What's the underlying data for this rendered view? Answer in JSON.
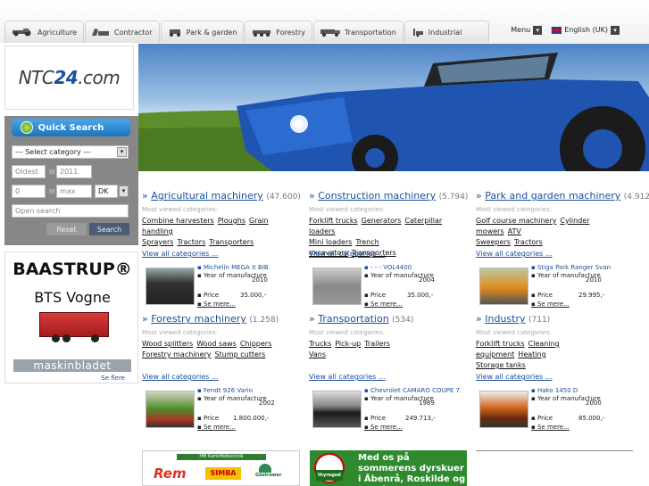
{
  "nav": {
    "tabs": [
      {
        "label": "Agriculture",
        "icon": "tractor-icon"
      },
      {
        "label": "Contractor",
        "icon": "excavator-icon"
      },
      {
        "label": "Park & garden",
        "icon": "mower-icon"
      },
      {
        "label": "Forestry",
        "icon": "forwarder-icon"
      },
      {
        "label": "Transportation",
        "icon": "truck-icon"
      },
      {
        "label": "Industrial",
        "icon": "forklift-icon"
      }
    ],
    "menu_label": "Menu",
    "language_label": "English (UK)"
  },
  "logo": {
    "text_a": "NTC",
    "text_b": "24",
    "text_c": ".com"
  },
  "quick_search": {
    "title": "Quick Search",
    "category_placeholder": "--- Select category ---",
    "year_from_placeholder": "Oldest",
    "year_to_value": "2011",
    "year_sep": "til",
    "price_from_value": "0",
    "price_to_placeholder": "max",
    "currency": "DK",
    "open_search_placeholder": "Open search",
    "reset_label": "Reset",
    "search_label": "Search"
  },
  "ads": {
    "baastrup_title": "BAASTRUP®",
    "baastrup_sub": "BTS Vogne",
    "maskinbladet": "maskinbladet",
    "see_more": "Se flere"
  },
  "categories": [
    {
      "title": "Agricultural machinery",
      "count": "(47.600)",
      "most_viewed": "Most viewed categories:",
      "links": [
        "Combine harvesters",
        "Ploughs",
        "Grain handling",
        "Sprayers",
        "Tractors",
        "Transporters"
      ],
      "view_all": "View all categories ...",
      "featured": {
        "title": "Michelin MEGA X BIB",
        "year_label": "Year of manufacture",
        "year": "2010",
        "price_label": "Price",
        "price": "35.000,-",
        "more": "Se mere..."
      }
    },
    {
      "title": "Construction machinery",
      "count": "(5.794)",
      "most_viewed": "Most viewed categories:",
      "links": [
        "Forklift trucks",
        "Generators",
        "Caterpillar loaders",
        "Mini loaders",
        "Trench excavators",
        "Transporters"
      ],
      "view_all": "View all categories ...",
      "featured": {
        "title": "- - - VOL4400",
        "year_label": "Year of manufacture",
        "year": "2004",
        "price_label": "Price",
        "price": "35.000,-",
        "more": "Se mere..."
      }
    },
    {
      "title": "Park and garden machinery",
      "count": "(4.912)",
      "most_viewed": "Most viewed categories:",
      "links": [
        "Golf course machinery",
        "Cylinder mowers",
        "ATV",
        "Sweepers",
        "Tractors"
      ],
      "view_all": "View all categories ...",
      "featured": {
        "title": "Stiga Park Ranger Svan",
        "year_label": "Year of manufacture",
        "year": "2010",
        "price_label": "Price",
        "price": "29.995,-",
        "more": "Se mere..."
      }
    },
    {
      "title": "Forestry machinery",
      "count": "(1.258)",
      "most_viewed": "Most viewed categories:",
      "links": [
        "Wood splitters",
        "Wood saws",
        "Chippers",
        "Forestry machinery",
        "Stump cutters"
      ],
      "view_all": "View all categories ...",
      "featured": {
        "title": "Fendt 926 Vario",
        "year_label": "Year of manufacture",
        "year": "2002",
        "price_label": "Price",
        "price": "1.800.000,-",
        "more": "Se mere..."
      }
    },
    {
      "title": "Transportation",
      "count": "(534)",
      "most_viewed": "Most viewed categories:",
      "links": [
        "Trucks",
        "Pick-up",
        "Trailers",
        "Vans"
      ],
      "view_all": "View all categories ...",
      "featured": {
        "title": "Chevrolet CAMARO COUPE 7.",
        "year_label": "Year of manufacture",
        "year": "1989",
        "price_label": "Price",
        "price": "249.713,-",
        "more": "Se mere..."
      }
    },
    {
      "title": "Industry",
      "count": "(711)",
      "most_viewed": "Most viewed categories:",
      "links": [
        "Forklift trucks",
        "Cleaning equipment",
        "Heating",
        "Storage tanks"
      ],
      "view_all": "View all categories ...",
      "featured": {
        "title": "Hako 1450 D",
        "year_label": "Year of manufacture",
        "year": "2000",
        "price_label": "Price",
        "price": "85.000,-",
        "more": "Se mere..."
      }
    }
  ],
  "bottom": {
    "kartoffel_label": "HM Kartoffeltechnik",
    "brand_a": "Rem",
    "brand_b": "SIMBA",
    "brand_c": "Güstrower",
    "banner_text": "Med os på sommerens dyrskuer i Åbenrå, Roskilde og Herning",
    "banner_brand": "thyregod"
  },
  "colors": {
    "accent": "#1a4f9c",
    "quick_search": "#2a8ad6",
    "sidebar": "#878787"
  }
}
